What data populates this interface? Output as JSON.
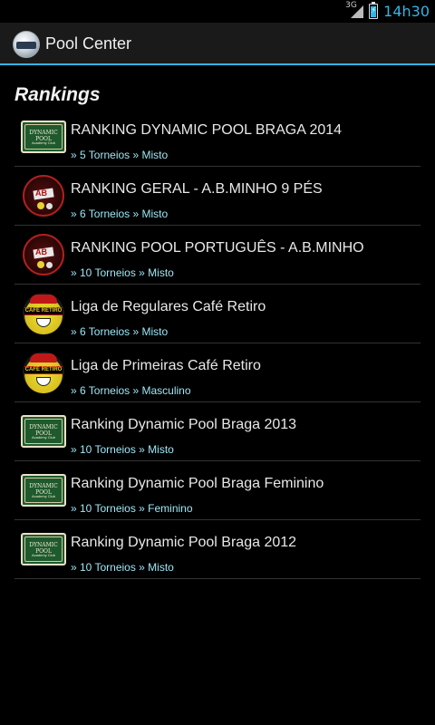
{
  "status_bar": {
    "network": "3G",
    "time": "14h30"
  },
  "action_bar": {
    "title": "Pool Center"
  },
  "section": {
    "title": "Rankings"
  },
  "rankings": [
    {
      "title": "RANKING DYNAMIC POOL BRAGA 2014",
      "sub": "» 5 Torneios » Misto",
      "logo": "dynamic-pool-logo"
    },
    {
      "title": "RANKING GERAL - A.B.MINHO 9 PÉS",
      "sub": "» 6 Torneios » Misto",
      "logo": "ab-minho-logo"
    },
    {
      "title": "RANKING POOL PORTUGUÊS - A.B.MINHO",
      "sub": "» 10 Torneios » Misto",
      "logo": "ab-minho-logo"
    },
    {
      "title": "Liga de Regulares Café Retiro",
      "sub": "» 6 Torneios » Misto",
      "logo": "cafe-retiro-logo"
    },
    {
      "title": "Liga de Primeiras Café Retiro",
      "sub": "» 6 Torneios » Masculino",
      "logo": "cafe-retiro-logo"
    },
    {
      "title": "Ranking Dynamic Pool Braga 2013",
      "sub": "» 10 Torneios » Misto",
      "logo": "dynamic-pool-logo"
    },
    {
      "title": "Ranking Dynamic Pool Braga Feminino",
      "sub": "» 10 Torneios » Feminino",
      "logo": "dynamic-pool-logo"
    },
    {
      "title": "Ranking Dynamic Pool Braga 2012",
      "sub": "» 10 Torneios » Misto",
      "logo": "dynamic-pool-logo"
    }
  ],
  "logos": {
    "dynamic": {
      "line1": "DYNAMIC POOL",
      "line2": "Academy Club"
    },
    "ab": {
      "text": "AB"
    },
    "cafe": {
      "text": "CAFÉ RETIRO"
    }
  },
  "colors": {
    "accent": "#33b5e5",
    "subtitle": "#9ee6f5",
    "background": "#000000"
  }
}
